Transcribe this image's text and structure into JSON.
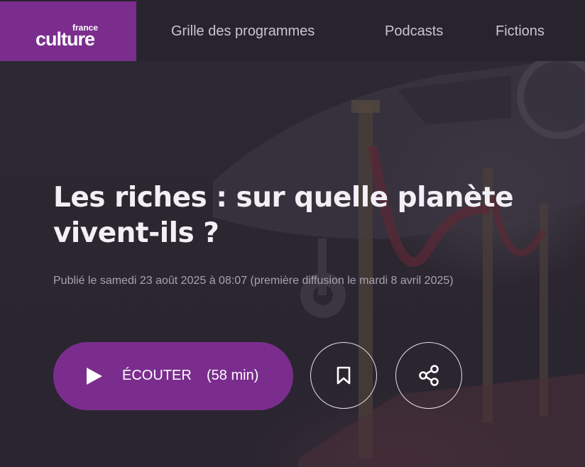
{
  "brand": {
    "small": "france",
    "big": "culture",
    "color": "#7b2d8e"
  },
  "nav": {
    "items": [
      {
        "label": "Grille des programmes"
      },
      {
        "label": "Podcasts"
      },
      {
        "label": "Fictions"
      }
    ]
  },
  "episode": {
    "title": "Les riches : sur quelle planète vivent-ils ?",
    "meta": "Publié le samedi 23 août 2025 à 08:07 (première diffusion le mardi 8 avril 2025)"
  },
  "actions": {
    "listen_label": "ÉCOUTER",
    "listen_duration": "(58 min)",
    "icons": [
      "play-icon",
      "bookmark-icon",
      "share-icon"
    ]
  },
  "colors": {
    "accent": "#7b2d8e",
    "background": "#2a2631"
  }
}
